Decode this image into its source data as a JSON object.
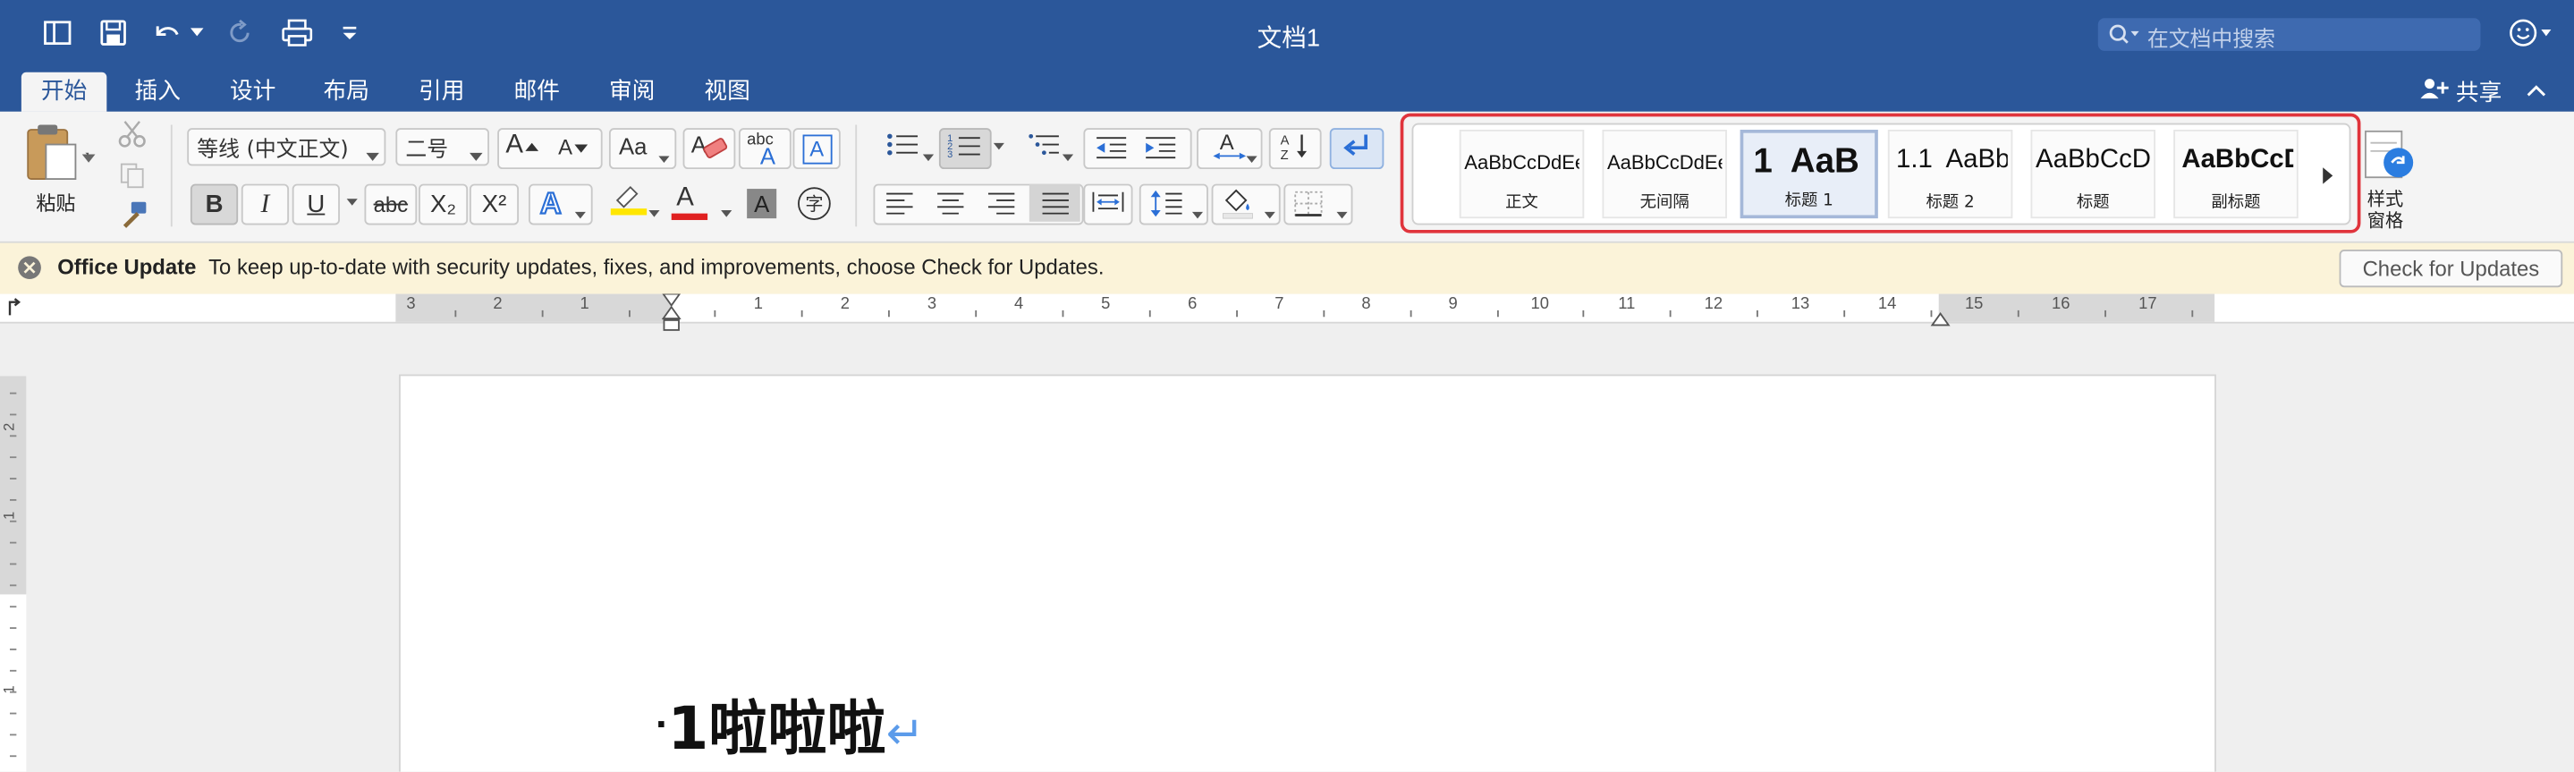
{
  "window": {
    "title": "文档1"
  },
  "search": {
    "placeholder": "在文档中搜索"
  },
  "tabs": [
    "开始",
    "插入",
    "设计",
    "布局",
    "引用",
    "邮件",
    "审阅",
    "视图"
  ],
  "share": {
    "label": "共享"
  },
  "clipboard": {
    "paste_label": "粘贴"
  },
  "font": {
    "name": "等线 (中文正文)",
    "size": "二号"
  },
  "format_buttons": {
    "bold": "B",
    "italic": "I",
    "underline": "U",
    "strike": "abc",
    "subscript": "X₂",
    "superscript": "X²",
    "text_effects": "A",
    "font_color": "A",
    "char_shading": "A",
    "enclose": "字",
    "grow": "A",
    "shrink": "A",
    "change_case": "Aa",
    "abc": "abc",
    "abc_a": "A",
    "text_box": "A"
  },
  "styles": [
    {
      "sample": "AaBbCcDdEe",
      "name": "正文"
    },
    {
      "sample": "AaBbCcDdEe",
      "name": "无间隔"
    },
    {
      "sample": "1  AaB",
      "name": "标题 1"
    },
    {
      "sample": "1.1  AaBb",
      "name": "标题 2"
    },
    {
      "sample": "AaBbCcD",
      "name": "标题"
    },
    {
      "sample": "AaBbCcD",
      "name": "副标题"
    }
  ],
  "styles_pane": {
    "label_line1": "样式",
    "label_line2": "窗格"
  },
  "infobar": {
    "title": "Office Update",
    "message": "To keep up-to-date with security updates, fixes, and improvements, choose Check for Updates.",
    "button": "Check for Updates"
  },
  "ruler": {
    "left_numbers": [
      "3",
      "2",
      "1"
    ],
    "right_numbers": [
      "1",
      "2",
      "3",
      "4",
      "5",
      "6",
      "7",
      "8",
      "9",
      "10",
      "11",
      "12",
      "13",
      "14",
      "15",
      "16",
      "17"
    ],
    "vertical_numbers": [
      "2",
      "1",
      "1"
    ]
  },
  "document": {
    "bullet": "·",
    "heading_text": "1啦啦啦",
    "para_mark": "↵"
  },
  "colors": {
    "accent": "#2b579a",
    "highlight": "#ffe600",
    "font_color": "#e02020",
    "gallery_outline": "#e0343c"
  }
}
